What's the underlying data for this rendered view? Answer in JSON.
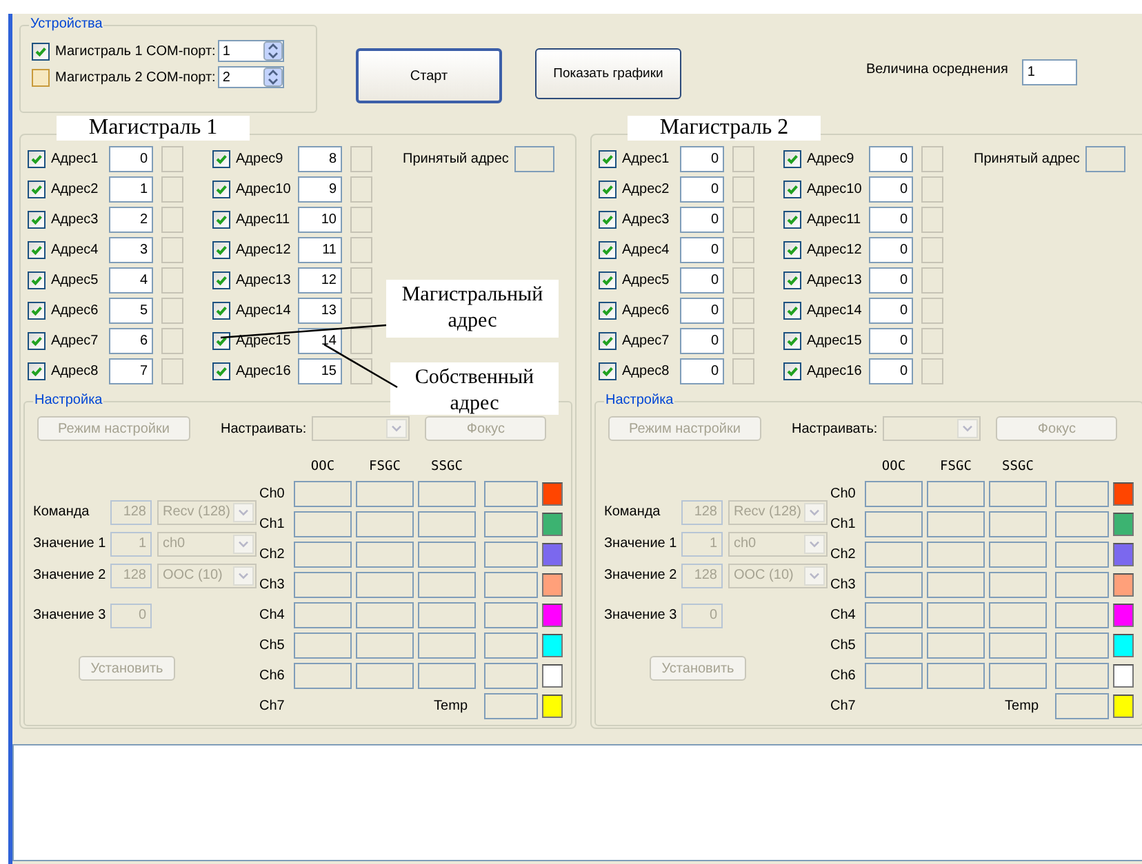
{
  "devices": {
    "title": "Устройства",
    "lines": [
      {
        "label": "Магистраль 1",
        "checked": true,
        "port_label": "COM-порт:",
        "port": "1"
      },
      {
        "label": "Магистраль 2",
        "checked": false,
        "port_label": "COM-порт:",
        "port": "2"
      }
    ]
  },
  "start_button": "Старт",
  "graphs_button": "Показать графики",
  "averaging": {
    "label": "Величина осреднения",
    "value": "1"
  },
  "buses": [
    {
      "caption": "Магистраль 1",
      "received_label": "Принятый адрес",
      "addresses": [
        {
          "label": "Адрес1",
          "checked": true,
          "value": "0"
        },
        {
          "label": "Адрес2",
          "checked": true,
          "value": "1"
        },
        {
          "label": "Адрес3",
          "checked": true,
          "value": "2"
        },
        {
          "label": "Адрес4",
          "checked": true,
          "value": "3"
        },
        {
          "label": "Адрес5",
          "checked": true,
          "value": "4"
        },
        {
          "label": "Адрес6",
          "checked": true,
          "value": "5"
        },
        {
          "label": "Адрес7",
          "checked": true,
          "value": "6"
        },
        {
          "label": "Адрес8",
          "checked": true,
          "value": "7"
        },
        {
          "label": "Адрес9",
          "checked": true,
          "value": "8"
        },
        {
          "label": "Адрес10",
          "checked": true,
          "value": "9"
        },
        {
          "label": "Адрес11",
          "checked": true,
          "value": "10"
        },
        {
          "label": "Адрес12",
          "checked": true,
          "value": "11"
        },
        {
          "label": "Адрес13",
          "checked": true,
          "value": "12"
        },
        {
          "label": "Адрес14",
          "checked": true,
          "value": "13"
        },
        {
          "label": "Адрес15",
          "checked": true,
          "value": "14"
        },
        {
          "label": "Адрес16",
          "checked": true,
          "value": "15"
        }
      ],
      "settings": {
        "title": "Настройка",
        "disabled": true,
        "mode_button": "Режим настройки",
        "tune_label": "Настраивать:",
        "focus_button": "Фокус",
        "set_button": "Установить",
        "params": [
          {
            "label": "Команда",
            "number": "128",
            "option": "Recv (128)"
          },
          {
            "label": "Значение 1",
            "number": "1",
            "option": "ch0"
          },
          {
            "label": "Значение 2",
            "number": "128",
            "option": "ООС (10)"
          },
          {
            "label": "Значение 3",
            "number": "0"
          }
        ],
        "columns": [
          "ООС",
          "FSGC",
          "SSGC"
        ],
        "channels": [
          {
            "name": "Ch0",
            "kind": "fields",
            "color": "#ff4500"
          },
          {
            "name": "Ch1",
            "kind": "fields",
            "color": "#3cb371"
          },
          {
            "name": "Ch2",
            "kind": "fields",
            "color": "#7b68ee"
          },
          {
            "name": "Ch3",
            "kind": "fields",
            "color": "#ffa07a"
          },
          {
            "name": "Ch4",
            "kind": "fields",
            "color": "#ff00ff"
          },
          {
            "name": "Ch5",
            "kind": "fields",
            "color": "#00ffff"
          },
          {
            "name": "Ch6",
            "kind": "fields",
            "color": "#ffffff"
          },
          {
            "name": "Ch7",
            "kind": "temp",
            "temp_label": "Temp",
            "color": "#ffff00"
          }
        ]
      }
    },
    {
      "caption": "Магистраль 2",
      "received_label": "Принятый адрес",
      "addresses": [
        {
          "label": "Адрес1",
          "checked": true,
          "value": "0"
        },
        {
          "label": "Адрес2",
          "checked": true,
          "value": "0"
        },
        {
          "label": "Адрес3",
          "checked": true,
          "value": "0"
        },
        {
          "label": "Адрес4",
          "checked": true,
          "value": "0"
        },
        {
          "label": "Адрес5",
          "checked": true,
          "value": "0"
        },
        {
          "label": "Адрес6",
          "checked": true,
          "value": "0"
        },
        {
          "label": "Адрес7",
          "checked": true,
          "value": "0"
        },
        {
          "label": "Адрес8",
          "checked": true,
          "value": "0"
        },
        {
          "label": "Адрес9",
          "checked": true,
          "value": "0"
        },
        {
          "label": "Адрес10",
          "checked": true,
          "value": "0"
        },
        {
          "label": "Адрес11",
          "checked": true,
          "value": "0"
        },
        {
          "label": "Адрес12",
          "checked": true,
          "value": "0"
        },
        {
          "label": "Адрес13",
          "checked": true,
          "value": "0"
        },
        {
          "label": "Адрес14",
          "checked": true,
          "value": "0"
        },
        {
          "label": "Адрес15",
          "checked": true,
          "value": "0"
        },
        {
          "label": "Адрес16",
          "checked": true,
          "value": "0"
        }
      ],
      "settings": {
        "title": "Настройка",
        "disabled": true,
        "mode_button": "Режим настройки",
        "tune_label": "Настраивать:",
        "focus_button": "Фокус",
        "set_button": "Установить",
        "params": [
          {
            "label": "Команда",
            "number": "128",
            "option": "Recv (128)"
          },
          {
            "label": "Значение 1",
            "number": "1",
            "option": "ch0"
          },
          {
            "label": "Значение 2",
            "number": "128",
            "option": "ООС (10)"
          },
          {
            "label": "Значение 3",
            "number": "0"
          }
        ],
        "columns": [
          "ООС",
          "FSGC",
          "SSGC"
        ],
        "channels": [
          {
            "name": "Ch0",
            "kind": "fields",
            "color": "#ff4500"
          },
          {
            "name": "Ch1",
            "kind": "fields",
            "color": "#3cb371"
          },
          {
            "name": "Ch2",
            "kind": "fields",
            "color": "#7b68ee"
          },
          {
            "name": "Ch3",
            "kind": "fields",
            "color": "#ffa07a"
          },
          {
            "name": "Ch4",
            "kind": "fields",
            "color": "#ff00ff"
          },
          {
            "name": "Ch5",
            "kind": "fields",
            "color": "#00ffff"
          },
          {
            "name": "Ch6",
            "kind": "fields",
            "color": "#ffffff"
          },
          {
            "name": "Ch7",
            "kind": "temp",
            "temp_label": "Temp",
            "color": "#ffff00"
          }
        ]
      }
    }
  ],
  "annotations": [
    {
      "text": "Магистральный адрес"
    },
    {
      "text": "Собственный адрес"
    }
  ]
}
